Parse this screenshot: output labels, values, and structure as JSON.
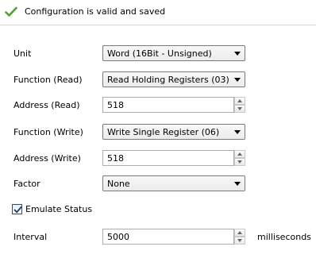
{
  "status": {
    "icon": "check-icon",
    "message": "Configuration is valid and saved",
    "icon_color": "#4aa52a"
  },
  "form": {
    "unit": {
      "label": "Unit",
      "value": "Word (16Bit - Unsigned)"
    },
    "function_read": {
      "label": "Function (Read)",
      "value": "Read Holding Registers (03)"
    },
    "address_read": {
      "label": "Address (Read)",
      "value": "518"
    },
    "function_write": {
      "label": "Function (Write)",
      "value": "Write Single Register (06)"
    },
    "address_write": {
      "label": "Address (Write)",
      "value": "518"
    },
    "factor": {
      "label": "Factor",
      "value": "None"
    },
    "emulate_status": {
      "label": "Emulate Status",
      "checked": true
    },
    "interval": {
      "label": "Interval",
      "value": "5000",
      "units": "milliseconds"
    }
  }
}
